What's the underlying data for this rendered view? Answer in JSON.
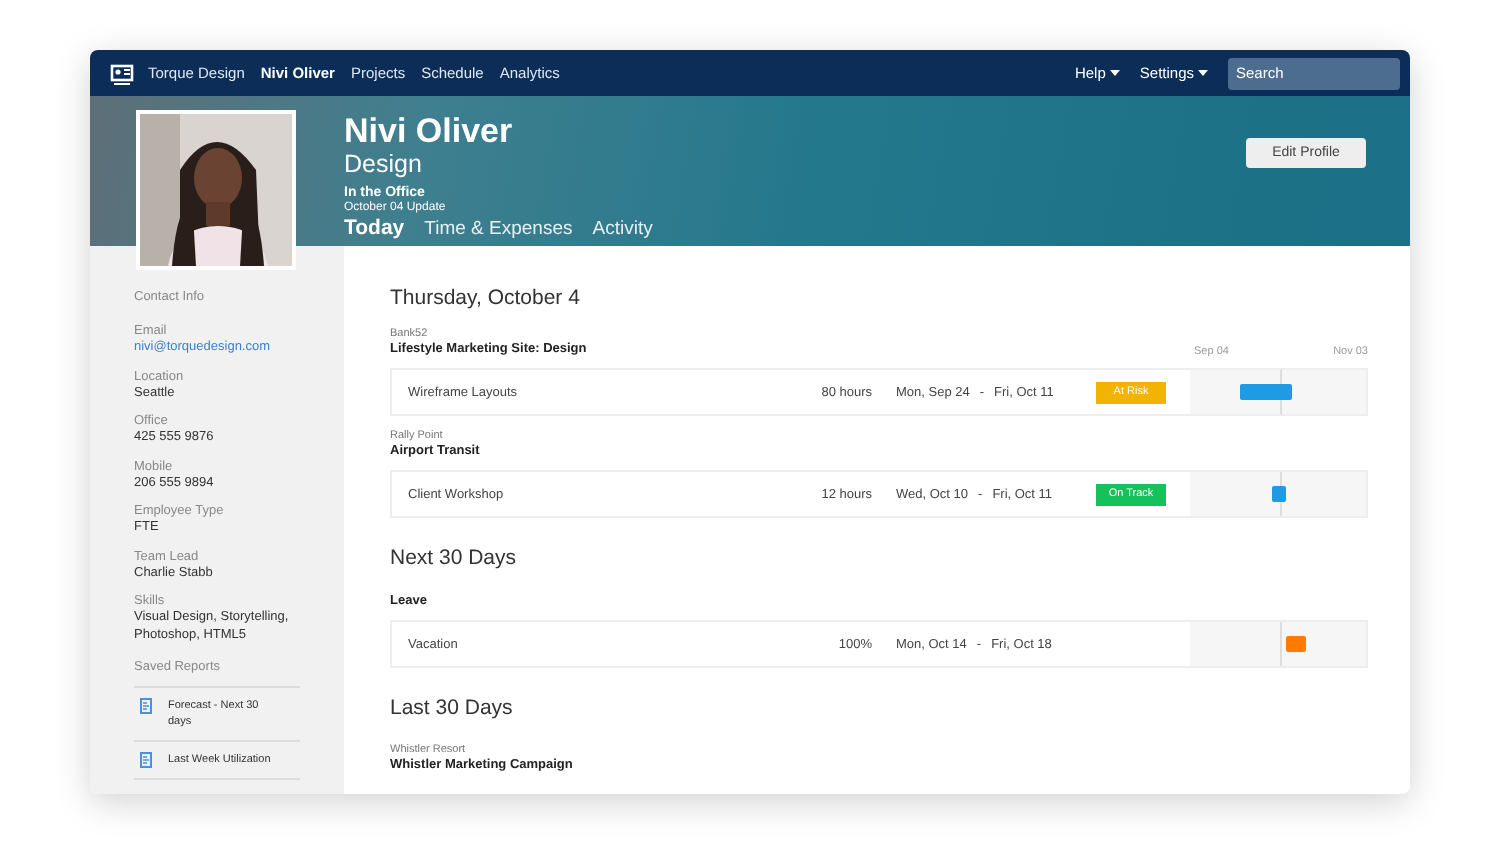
{
  "nav": {
    "brand": "Torque Design",
    "items": [
      {
        "label": "Nivi Oliver",
        "selected": true
      },
      {
        "label": "Projects",
        "selected": false
      },
      {
        "label": "Schedule",
        "selected": false
      },
      {
        "label": "Analytics",
        "selected": false
      }
    ],
    "menus": [
      "Help",
      "Settings"
    ],
    "search": {
      "placeholder": "Search"
    }
  },
  "profile": {
    "name": "Nivi Oliver",
    "department": "Design",
    "status": "In the Office",
    "status_note": "October 04 Update",
    "edit_button": "Edit Profile",
    "tabs": [
      {
        "label": "Today",
        "selected": true
      },
      {
        "label": "Time & Expenses",
        "selected": false
      },
      {
        "label": "Activity",
        "selected": false
      }
    ]
  },
  "sidebar": {
    "heading": "Contact Info",
    "fields": [
      {
        "label": "Email",
        "value": "nivi@torquedesign.com",
        "kind": "link"
      },
      {
        "label": "Location",
        "value": "Seattle",
        "kind": "text"
      },
      {
        "label": "Office",
        "value": "425 555 9876",
        "kind": "text"
      },
      {
        "label": "Mobile",
        "value": "206 555 9894",
        "kind": "text"
      },
      {
        "label": "Employee Type",
        "value": "FTE",
        "kind": "text"
      },
      {
        "label": "Team Lead",
        "value": "Charlie Stabb",
        "kind": "text"
      },
      {
        "label": "Skills",
        "value": "Visual Design, Storytelling, Photoshop, HTML5",
        "kind": "text"
      }
    ],
    "saved_reports": {
      "heading": "Saved Reports",
      "items": [
        "Forecast - Next 30 days",
        "Last Week Utilization"
      ]
    }
  },
  "schedule": {
    "timeline": {
      "start": "Sep 04",
      "end": "Nov 03"
    },
    "sections": [
      {
        "title": "Thursday, October 4",
        "groups": [
          {
            "client": "Bank52",
            "project": "Lifestyle Marketing Site: Design",
            "tasks": [
              {
                "name": "Wireframe Layouts",
                "amount": "80 hours",
                "start": "Mon, Sep 24",
                "dash": "-",
                "end": "Fri, Oct 11",
                "status": {
                  "label": "At Risk",
                  "color": "#f2b400"
                },
                "bar": {
                  "color": "#1f9be6"
                }
              }
            ]
          },
          {
            "client": "Rally Point",
            "project": "Airport Transit",
            "tasks": [
              {
                "name": "Client Workshop",
                "amount": "12 hours",
                "start": "Wed, Oct 10",
                "dash": "-",
                "end": "Fri, Oct 11",
                "status": {
                  "label": "On Track",
                  "color": "#14c15a"
                },
                "bar": {
                  "color": "#1f9be6"
                }
              }
            ]
          }
        ]
      },
      {
        "title": "Next 30 Days",
        "groups": [
          {
            "project": "Leave",
            "tasks": [
              {
                "name": "Vacation",
                "amount": "100%",
                "start": "Mon, Oct 14",
                "dash": "-",
                "end": "Fri, Oct 18",
                "bar": {
                  "color": "#ff7a00"
                }
              }
            ]
          }
        ]
      },
      {
        "title": "Last 30 Days",
        "groups": [
          {
            "client": "Whistler Resort",
            "project": "Whistler Marketing Campaign"
          }
        ]
      }
    ]
  }
}
